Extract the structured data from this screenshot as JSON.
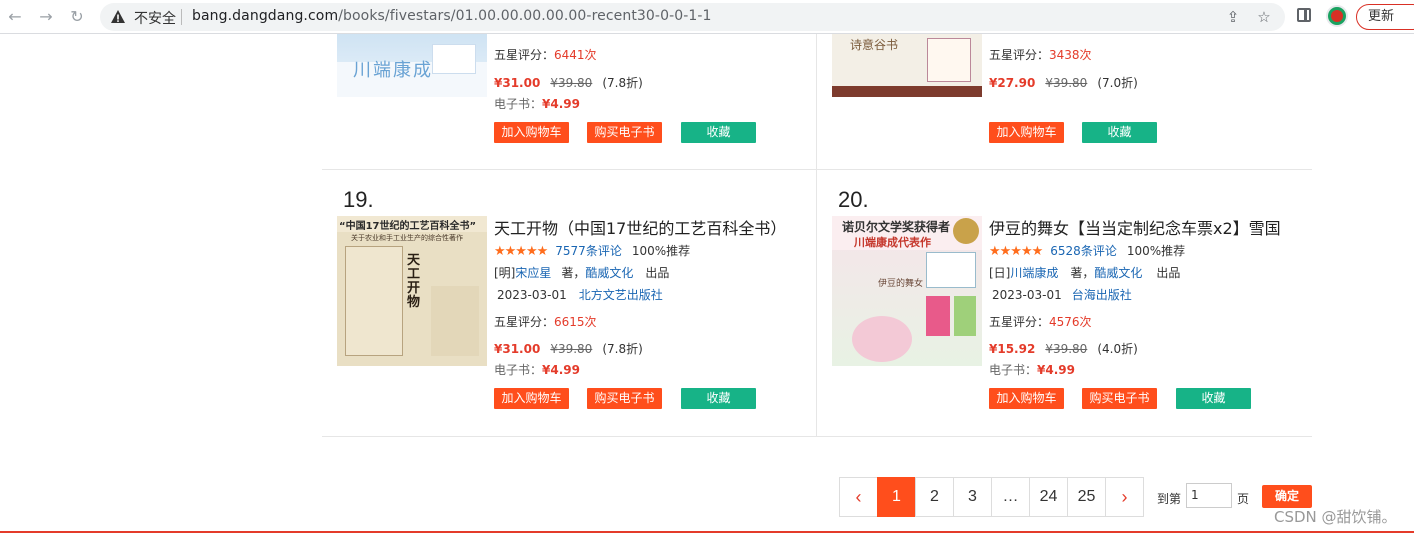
{
  "browser": {
    "insecure_label": "不安全",
    "url_host": "bang.dangdang.com",
    "url_path": "/books/fivestars/01.00.00.00.00.00-recent30-0-0-1-1",
    "update_label": "更新"
  },
  "top_items": [
    {
      "cover_text": "川端康成",
      "rating_label": "五星评分：",
      "rating_count": "6441次",
      "price": "¥31.00",
      "original_price": "¥39.80",
      "discount": "(7.8折)",
      "ebook_label": "电子书：",
      "ebook_price": "¥4.99",
      "buttons": {
        "cart": "加入购物车",
        "ebook": "购买电子书",
        "fav": "收藏"
      }
    },
    {
      "cover_text": "诗意谷书",
      "rating_label": "五星评分：",
      "rating_count": "3438次",
      "price": "¥27.90",
      "original_price": "¥39.80",
      "discount": "(7.0折)",
      "buttons": {
        "cart": "加入购物车",
        "fav": "收藏"
      }
    }
  ],
  "items": [
    {
      "rank": "19.",
      "title": "天工开物（中国17世纪的工艺百科全书）",
      "cover_banner": "“中国17世纪的工艺百科全书”",
      "cover_sub": "关于农业和手工业生产的综合性著作",
      "cover_title": "天工开物",
      "rating_stars": 5,
      "reviews": "7577条评论",
      "recommend": "100%推荐",
      "author_prefix": "[明]",
      "author": "宋应星",
      "author_suffix": "著，",
      "producer": "酷威文化",
      "producer_suffix": "出品",
      "date": "2023-03-01",
      "publisher": "北方文艺出版社",
      "rating_label": "五星评分：",
      "rating_count": "6615次",
      "price": "¥31.00",
      "original_price": "¥39.80",
      "discount": "(7.8折)",
      "ebook_label": "电子书：",
      "ebook_price": "¥4.99",
      "buttons": {
        "cart": "加入购物车",
        "ebook": "购买电子书",
        "fav": "收藏"
      }
    },
    {
      "rank": "20.",
      "title": "伊豆的舞女【当当定制纪念车票x2】雪国",
      "cover_banner": "诺贝尔文学奖获得者",
      "cover_sub": "川端康成代表作",
      "cover_title": "伊豆的舞女",
      "rating_stars": 5,
      "reviews": "6528条评论",
      "recommend": "100%推荐",
      "author_prefix": "[日]",
      "author": "川端康成",
      "author_suffix": "著，",
      "producer": "酷威文化",
      "producer_suffix": "出品",
      "date": "2023-03-01",
      "publisher": "台海出版社",
      "rating_label": "五星评分：",
      "rating_count": "4576次",
      "price": "¥15.92",
      "original_price": "¥39.80",
      "discount": "(4.0折)",
      "ebook_label": "电子书：",
      "ebook_price": "¥4.99",
      "buttons": {
        "cart": "加入购物车",
        "ebook": "购买电子书",
        "fav": "收藏"
      }
    }
  ],
  "pagination": {
    "prev": "‹",
    "pages": [
      "1",
      "2",
      "3",
      "…",
      "24",
      "25"
    ],
    "next": "›",
    "goto_label": "到第",
    "goto_value": "1",
    "page_label": "页",
    "confirm": "确定"
  },
  "watermark": "CSDN @甜饮铺。",
  "colors": {
    "accent": "#ff4e1c",
    "price": "#e43b2a",
    "link": "#1a66b3",
    "fav": "#17b387",
    "star": "#ff6d1d"
  }
}
